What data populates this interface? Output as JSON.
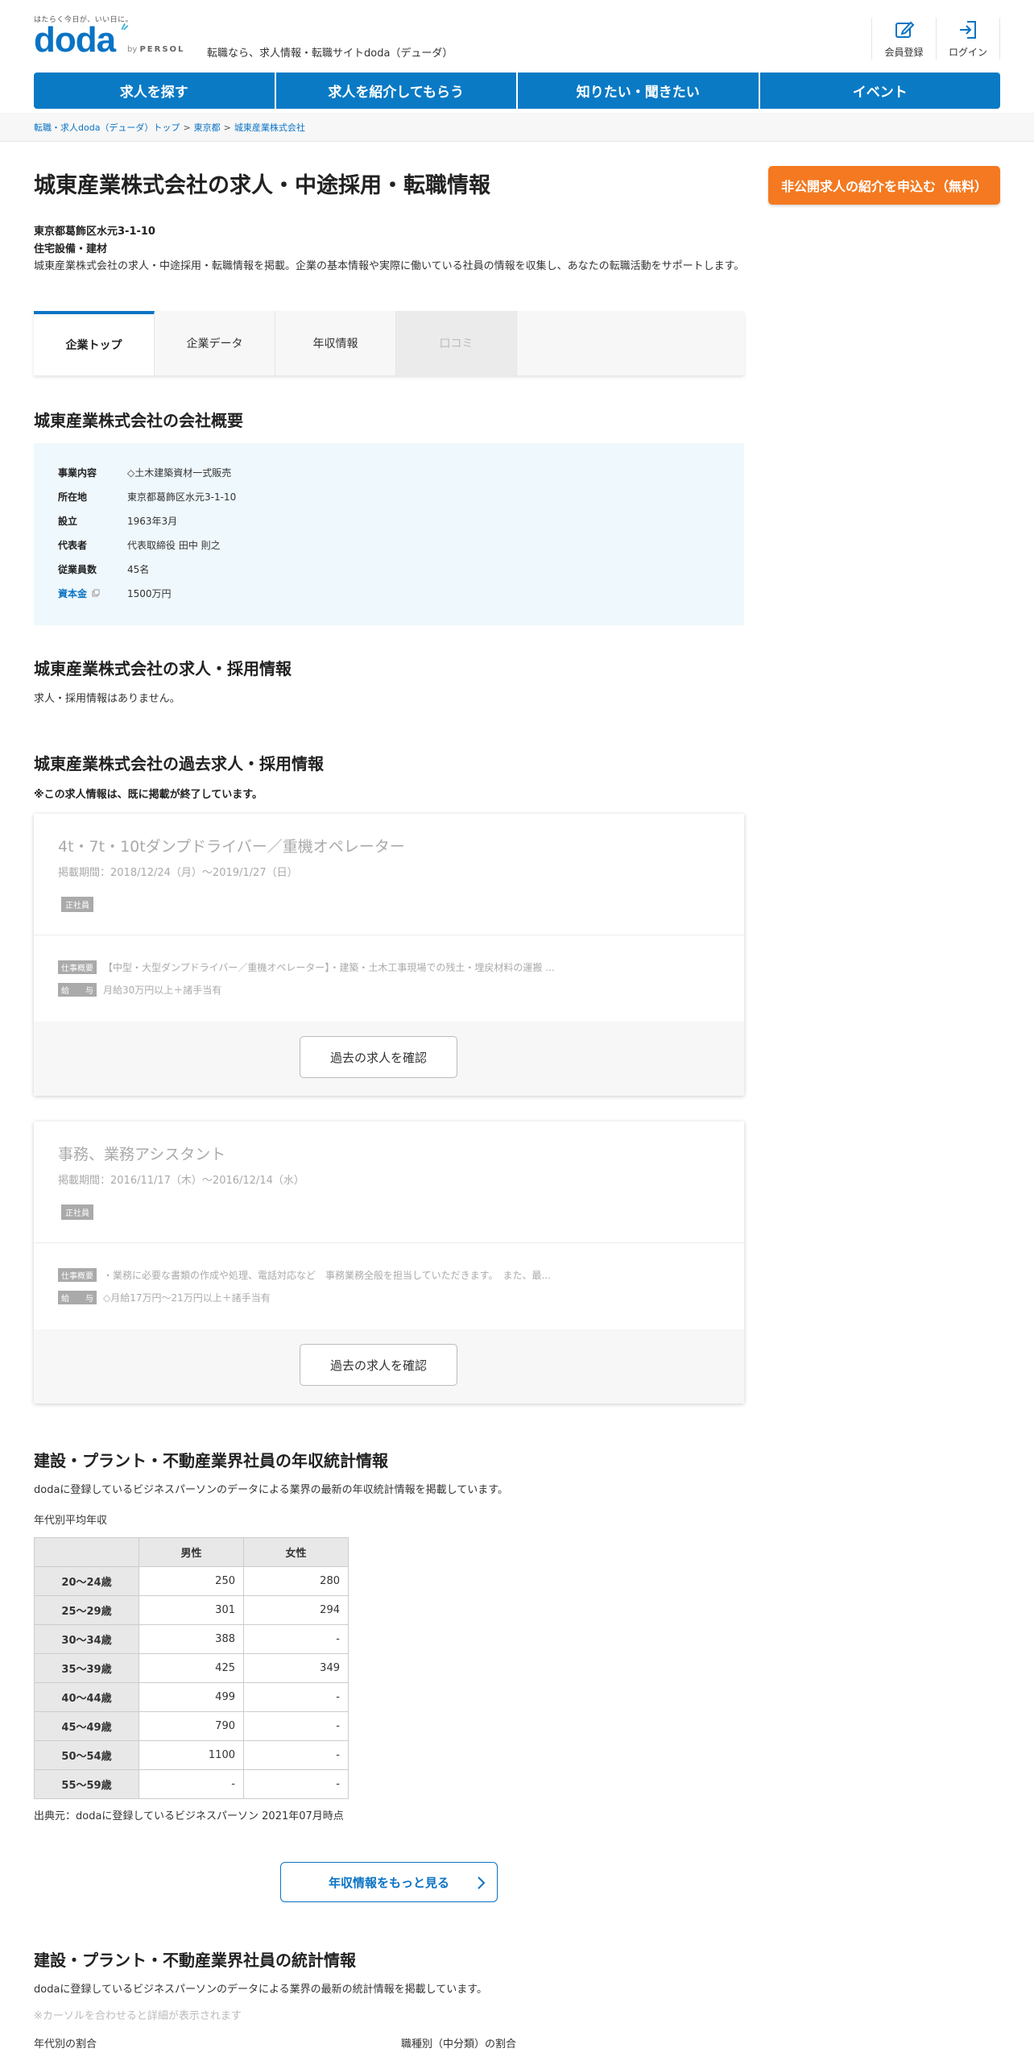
{
  "header": {
    "tagline": "はたらく今日が、いい日に。",
    "logo": "doda",
    "by": "by",
    "brand": "PERSOL",
    "site_desc": "転職なら、求人情報・転職サイトdoda（デューダ）",
    "register_label": "会員登録",
    "login_label": "ログイン"
  },
  "nav": {
    "items": [
      "求人を探す",
      "求人を紹介してもらう",
      "知りたい・聞きたい",
      "イベント"
    ]
  },
  "breadcrumb": {
    "items": [
      "転職・求人doda（デューダ）トップ",
      "東京都",
      "城東産業株式会社"
    ],
    "separator": ">"
  },
  "company": {
    "title": "城東産業株式会社の求人・中途採用・転職情報",
    "cta": "非公開求人の紹介を申込む（無料）",
    "address": "東京都葛飾区水元3-1-10",
    "industry": "住宅設備・建材",
    "intro": "城東産業株式会社の求人・中途採用・転職情報を掲載。企業の基本情報や実際に働いている社員の情報を収集し、あなたの転職活動をサポートします。"
  },
  "tabs": [
    "企業トップ",
    "企業データ",
    "年収情報",
    "口コミ"
  ],
  "overview": {
    "heading": "城東産業株式会社の会社概要",
    "rows": [
      {
        "key": "事業内容",
        "value": "◇土木建築資材一式販売"
      },
      {
        "key": "所在地",
        "value": "東京都葛飾区水元3-1-10"
      },
      {
        "key": "設立",
        "value": "1963年3月"
      },
      {
        "key": "代表者",
        "value": "代表取締役 田中 則之"
      },
      {
        "key": "従業員数",
        "value": "45名"
      },
      {
        "key": "資本金",
        "value": "1500万円"
      }
    ]
  },
  "current_jobs": {
    "heading": "城東産業株式会社の求人・採用情報",
    "empty": "求人・採用情報はありません。"
  },
  "past_jobs": {
    "heading": "城東産業株式会社の過去求人・採用情報",
    "note": "※この求人情報は、既に掲載が終了しています。",
    "button_label": "過去の求人を確認",
    "summary_label": "仕事概要",
    "salary_label": "給　　与",
    "items": [
      {
        "title": "4t・7t・10tダンプドライバー／重機オペレーター",
        "period": "掲載期間：2018/12/24（月）～2019/1/27（日）",
        "badge": "正社員",
        "summary": "【中型・大型ダンプドライバー／重機オペレーター】・建築・土木工事現場での残土・埋戻材料の運搬 ...",
        "salary": "月給30万円以上＋諸手当有"
      },
      {
        "title": "事務、業務アシスタント",
        "period": "掲載期間：2016/11/17（木）～2016/12/14（水）",
        "badge": "正社員",
        "summary": "・業務に必要な書類の作成や処理、電話対応など　事務業務全般を担当していただきます。　また、最...",
        "salary": "◇月給17万円～21万円以上＋諸手当有"
      }
    ]
  },
  "salary_stats": {
    "heading": "建設・プラント・不動産業界社員の年収統計情報",
    "desc": "dodaに登録しているビジネスパーソンのデータによる業界の最新の年収統計情報を掲載しています。",
    "table_caption": "年代別平均年収",
    "columns": [
      "男性",
      "女性"
    ],
    "rows": [
      {
        "age": "20～24歳",
        "male": "250",
        "female": "280"
      },
      {
        "age": "25～29歳",
        "male": "301",
        "female": "294"
      },
      {
        "age": "30～34歳",
        "male": "388",
        "female": "-"
      },
      {
        "age": "35～39歳",
        "male": "425",
        "female": "349"
      },
      {
        "age": "40～44歳",
        "male": "499",
        "female": "-"
      },
      {
        "age": "45～49歳",
        "male": "790",
        "female": "-"
      },
      {
        "age": "50～54歳",
        "male": "1100",
        "female": "-"
      },
      {
        "age": "55～59歳",
        "male": "-",
        "female": "-"
      }
    ],
    "source": "出典元：dodaに登録しているビジネスパーソン 2021年07月時点",
    "more_label": "年収情報をもっと見る"
  },
  "stats": {
    "heading": "建設・プラント・不動産業界社員の統計情報",
    "desc": "dodaに登録しているビジネスパーソンのデータによる業界の最新の統計情報を掲載しています。",
    "hint": "※カーソルを合わせると詳細が表示されます",
    "age_ratio_label": "年代別の割合",
    "job_ratio_label": "職種別（中分類）の割合"
  },
  "colors": {
    "brand": "#0a73c4",
    "nav": "#0a7ac5",
    "cta": "#f47920",
    "overview_bg": "#eff8fc"
  }
}
